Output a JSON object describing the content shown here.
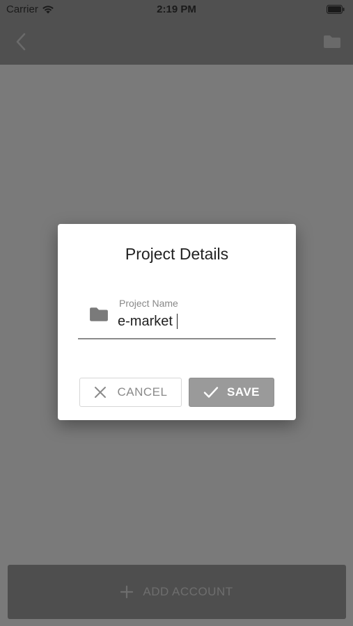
{
  "status_bar": {
    "carrier": "Carrier",
    "time": "2:19 PM",
    "wifi_icon": "wifi-icon",
    "battery_icon": "battery-icon"
  },
  "nav": {
    "back_icon": "chevron-left-icon",
    "folder_icon": "folder-icon"
  },
  "dialog": {
    "title": "Project Details",
    "field": {
      "label": "Project Name",
      "value": "e-market",
      "icon": "folder-icon"
    },
    "cancel_label": "CANCEL",
    "cancel_icon": "close-icon",
    "save_label": "SAVE",
    "save_icon": "check-icon"
  },
  "footer": {
    "add_account_label": "ADD ACCOUNT",
    "add_icon": "plus-icon"
  },
  "colors": {
    "overlay": "#7a7a7a",
    "nav_bg": "#505050",
    "dialog_bg": "#ffffff",
    "save_bg": "#9a9a9a"
  }
}
